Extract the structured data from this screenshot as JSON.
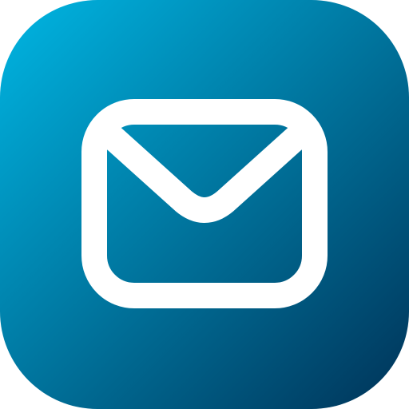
{
  "app_icon": {
    "icon": "mail-envelope-icon",
    "gradient_start": "#00B6E3",
    "gradient_end": "#003358",
    "glyph_color": "#FFFFFF"
  }
}
